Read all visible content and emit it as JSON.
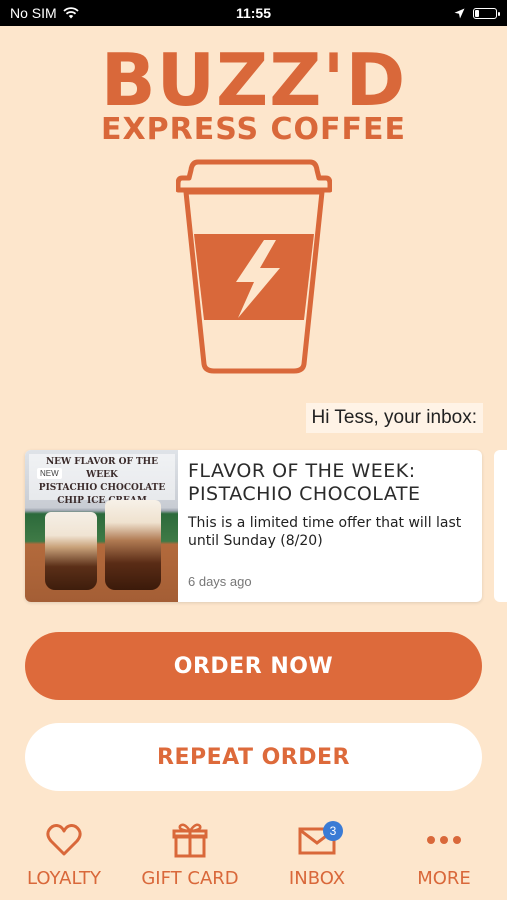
{
  "status_bar": {
    "carrier": "No SIM",
    "time": "11:55"
  },
  "brand": {
    "name": "BUZZ'D",
    "tagline": "EXPRESS COFFEE",
    "accent_color": "#d9683a"
  },
  "greeting": "Hi Tess, your inbox:",
  "inbox_card": {
    "image_text_line1": "NEW FLAVOR OF THE WEEK",
    "image_text_line2": "PISTACHIO CHOCOLATE",
    "image_text_line3": "CHIP ICE CREAM",
    "image_badge": "NEW",
    "title_line1": "FLAVOR OF THE WEEK:",
    "title_line2": "PISTACHIO CHOCOLATE",
    "description": "This is a limited time offer that will last until Sunday (8/20)",
    "time_ago": "6 days ago"
  },
  "buttons": {
    "order_now": "ORDER NOW",
    "repeat_order": "REPEAT ORDER"
  },
  "tabs": [
    {
      "label": "LOYALTY",
      "icon": "heart-icon"
    },
    {
      "label": "GIFT CARD",
      "icon": "gift-icon"
    },
    {
      "label": "INBOX",
      "icon": "envelope-icon",
      "badge": "3"
    },
    {
      "label": "MORE",
      "icon": "more-icon"
    }
  ]
}
